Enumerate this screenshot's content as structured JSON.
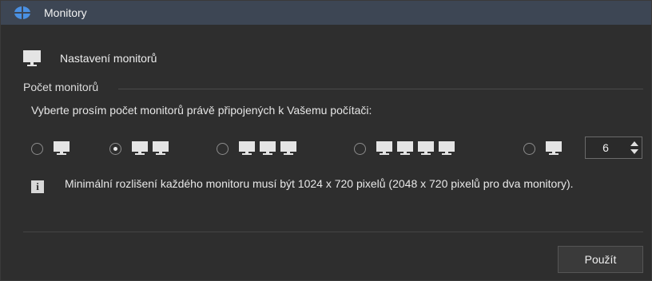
{
  "window": {
    "title": "Monitory"
  },
  "header": {
    "label": "Nastavení monitorů",
    "icon": "monitor-icon"
  },
  "group": {
    "label": "Počet monitorů"
  },
  "prompt": "Vyberte prosím počet monitorů právě připojených k Vašemu počítači:",
  "options": [
    {
      "monitors": 1,
      "selected": false
    },
    {
      "monitors": 2,
      "selected": true
    },
    {
      "monitors": 3,
      "selected": false
    },
    {
      "monitors": 4,
      "selected": false
    },
    {
      "monitors": "custom",
      "selected": false
    }
  ],
  "stepper": {
    "value": "6"
  },
  "info": {
    "icon": "info-icon",
    "text": "Minimální rozlišení každého monitoru musí být 1024 x 720 pixelů (2048 x 720 pixelů pro dva monitory)."
  },
  "buttons": {
    "apply": "Použít"
  },
  "colors": {
    "titlebar": "#3d4654",
    "background": "#2e2e2e",
    "app_icon_blue": "#4a90e2"
  }
}
